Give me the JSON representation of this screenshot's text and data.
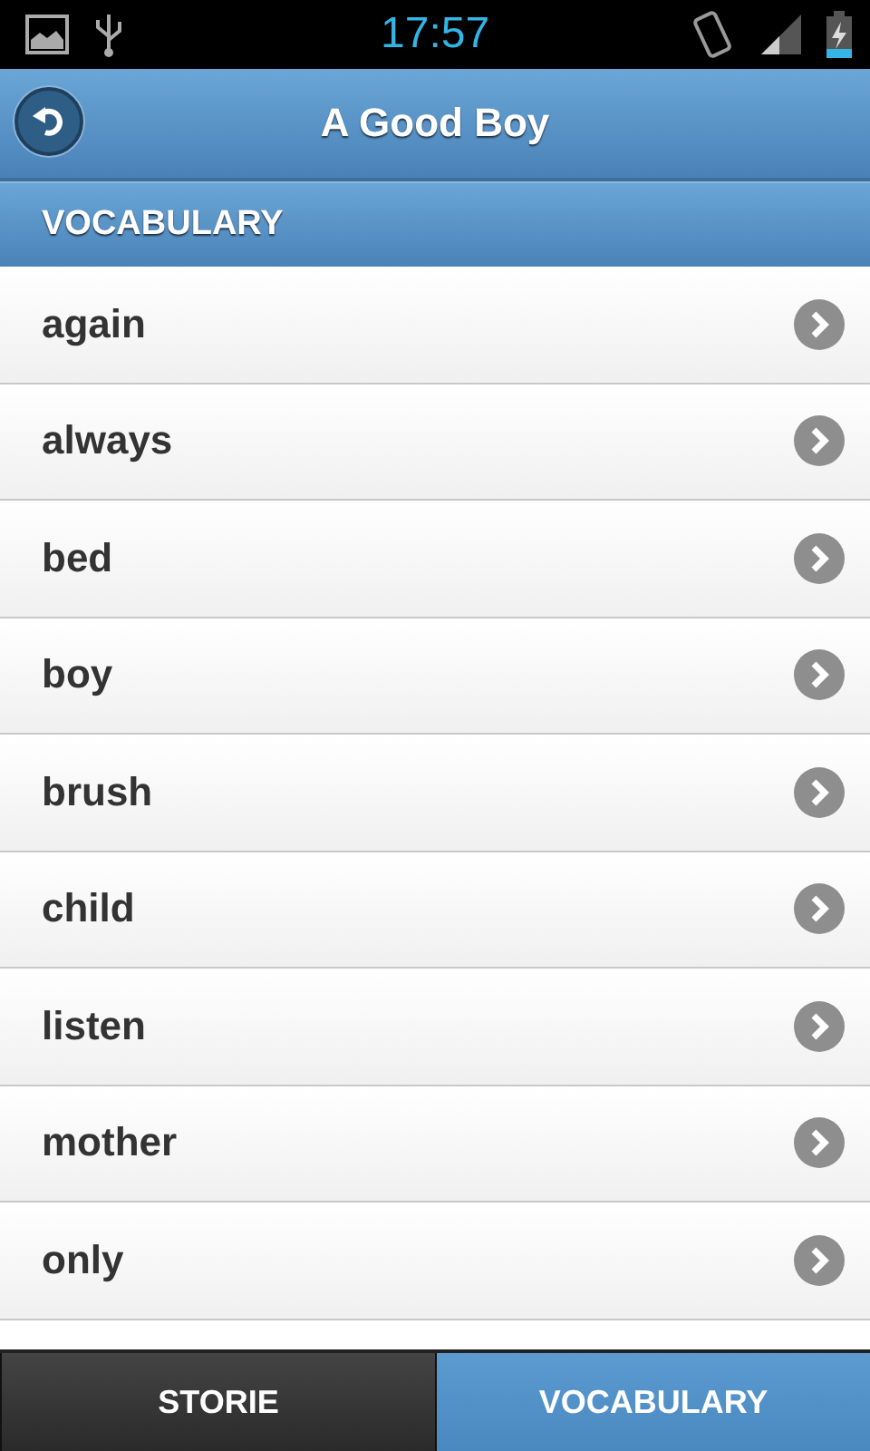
{
  "status_bar": {
    "time": "17:57"
  },
  "header": {
    "title": "A Good Boy"
  },
  "section": {
    "title": "VOCABULARY"
  },
  "words": [
    {
      "label": "again"
    },
    {
      "label": "always"
    },
    {
      "label": "bed"
    },
    {
      "label": "boy"
    },
    {
      "label": "brush"
    },
    {
      "label": "child"
    },
    {
      "label": "listen"
    },
    {
      "label": "mother"
    },
    {
      "label": "only"
    }
  ],
  "tabs": [
    {
      "label": "STORIE",
      "selected": false
    },
    {
      "label": "VOCABULARY",
      "selected": true
    }
  ]
}
